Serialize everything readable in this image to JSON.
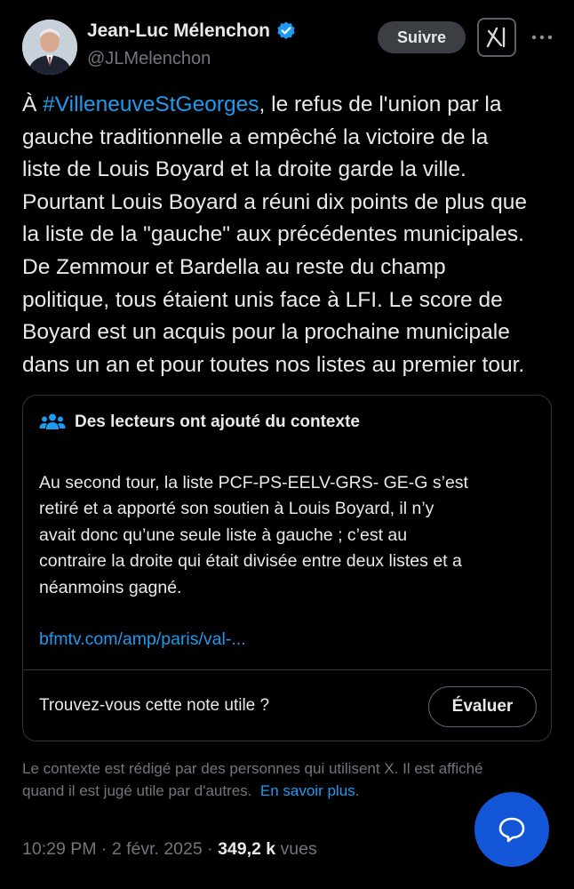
{
  "author": {
    "name": "Jean-Luc Mélenchon",
    "handle": "@JLMelenchon",
    "verified": true
  },
  "header": {
    "follow_label": "Suivre"
  },
  "tweet": {
    "lines": [
      {
        "hashtag_prefix": "À ",
        "hashtag": "#VilleneuveStGeorges",
        "rest": ", le refus de l'union par la"
      },
      "gauche traditionnelle a empêché la victoire de la",
      "liste de Louis Boyard et la droite garde la ville.",
      "Pourtant Louis Boyard a réuni dix points de plus que",
      "la liste de la \"gauche\" aux précédentes municipales.",
      "De Zemmour et Bardella au reste du champ",
      "politique, tous étaient unis face à LFI. Le score de",
      "Boyard est un acquis pour la prochaine municipale",
      "dans un an et pour toutes nos listes au premier tour."
    ]
  },
  "community_note": {
    "title": "Des lecteurs ont ajouté du contexte",
    "body_lines": [
      "Au second tour, la liste PCF-PS-EELV-GRS- GE-G s’est",
      "retiré et a apporté son soutien à Louis Boyard, il n’y",
      "avait donc qu’une seule liste à gauche ; c’est au",
      "contraire la droite qui était divisée entre deux listes et a",
      "néanmoins gagné."
    ],
    "link": "bfmtv.com/amp/paris/val-...",
    "question": "Trouvez-vous cette note utile ?",
    "rate_label": "Évaluer"
  },
  "disclaimer": {
    "line1": "Le contexte est rédigé par des personnes qui utilisent X. Il est affiché",
    "line2": "quand il est jugé utile par d'autres.",
    "learn_more": "En savoir plus",
    "period": "."
  },
  "meta": {
    "time": "10:29 PM",
    "separator": " · ",
    "date": "2 févr. 2025",
    "views_count": "349,2 k",
    "views_label": " vues"
  },
  "colors": {
    "background": "#000000",
    "text": "#e7e9ea",
    "secondary_text": "#71767b",
    "link": "#1d9bf0",
    "fab": "#1456d8",
    "border": "#2f3336"
  },
  "icons": {
    "verified": "verified-badge-icon",
    "grok": "grok-icon",
    "more": "more-dots-icon",
    "note_header": "people-icon",
    "fab": "chat-bubble-icon"
  }
}
